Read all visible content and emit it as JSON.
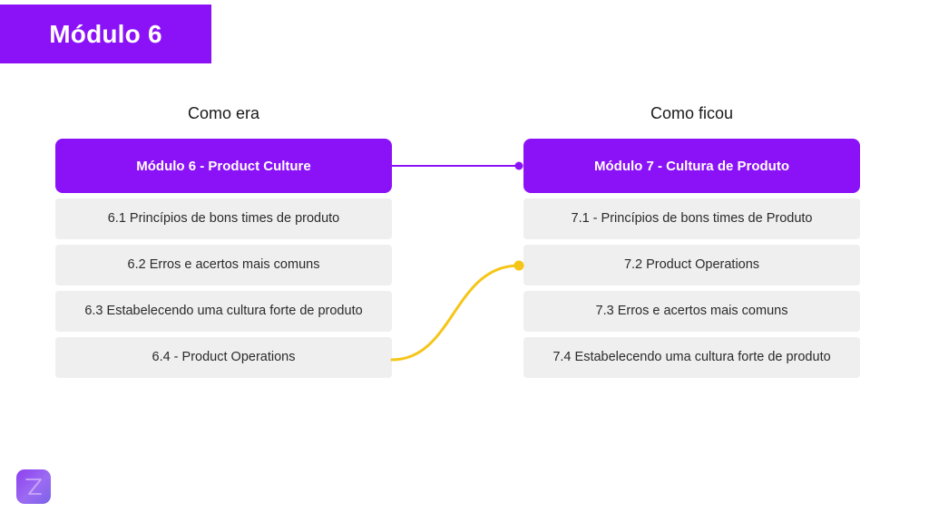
{
  "header": {
    "title": "Módulo 6",
    "background_color": "#8B12F7"
  },
  "columns": {
    "left": {
      "heading": "Como era",
      "module": {
        "label": "Módulo 6 - Product Culture",
        "color": "#8B12F7"
      },
      "items": [
        {
          "label": "6.1 Princípios de bons times de produto"
        },
        {
          "label": "6.2 Erros e acertos mais comuns"
        },
        {
          "label": "6.3 Estabelecendo uma cultura forte de produto"
        },
        {
          "label": "6.4 - Product Operations"
        }
      ]
    },
    "right": {
      "heading": "Como ficou",
      "module": {
        "label": "Módulo 7 - Cultura de Produto",
        "color": "#8B12F7"
      },
      "items": [
        {
          "label": "7.1 - Princípios de bons times de Produto"
        },
        {
          "label": "7.2 Product Operations"
        },
        {
          "label": "7.3 Erros e acertos mais comuns"
        },
        {
          "label": "7.4 Estabelecendo uma cultura forte de produto"
        }
      ]
    }
  },
  "connectors": [
    {
      "name": "module-link",
      "color": "#8B12F7",
      "from": "Módulo 6 - Product Culture",
      "to": "Módulo 7 - Cultura de Produto"
    },
    {
      "name": "product-operations-link",
      "color": "#F5C518",
      "from": "6.4 - Product Operations",
      "to": "7.2 Product Operations"
    }
  ],
  "logo": {
    "name": "brand-logo",
    "gradient_start": "#8E3FF0",
    "gradient_end": "#7B63E8"
  }
}
